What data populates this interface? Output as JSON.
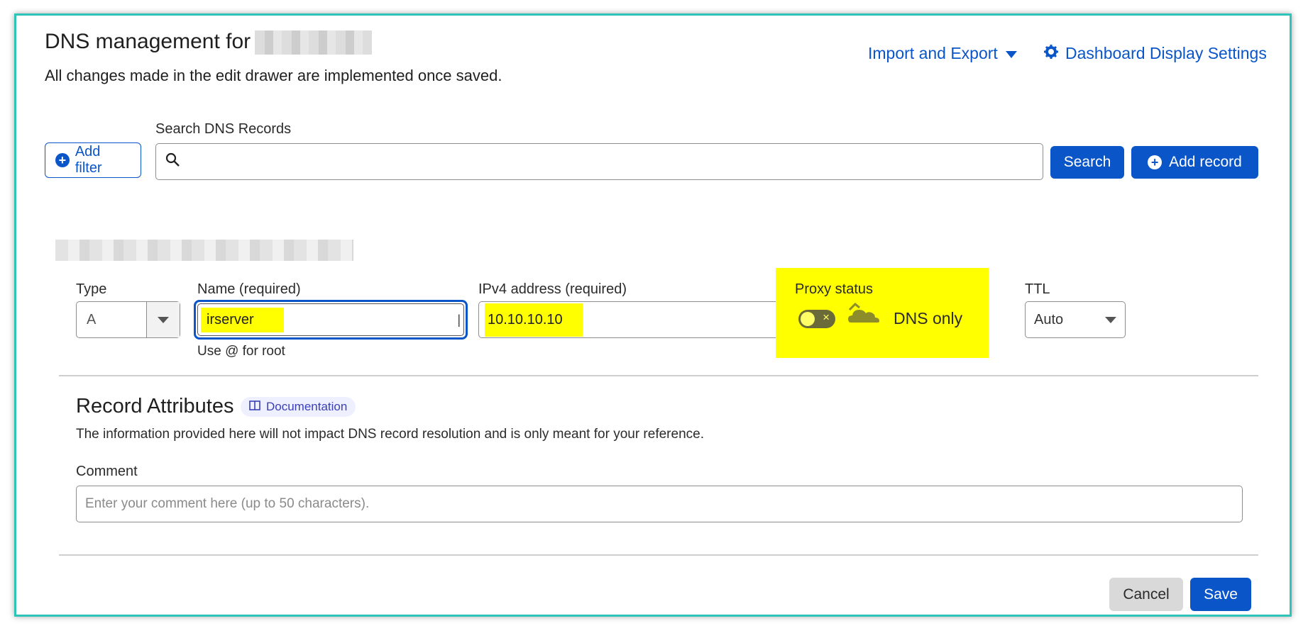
{
  "header": {
    "title": "DNS management for",
    "subtitle": "All changes made in the edit drawer are implemented once saved.",
    "import_export_label": "Import and Export",
    "dashboard_settings_label": "Dashboard Display Settings"
  },
  "search": {
    "add_filter_label": "Add filter",
    "label": "Search DNS Records",
    "value": "",
    "search_button_label": "Search",
    "add_record_label": "Add record"
  },
  "record_form": {
    "type_label": "Type",
    "type_value": "A",
    "name_label": "Name (required)",
    "name_value": "irserver",
    "name_hint": "Use @ for root",
    "ipv4_label": "IPv4 address (required)",
    "ipv4_value": "10.10.10.10",
    "proxy_label": "Proxy status",
    "proxy_value": "DNS only",
    "ttl_label": "TTL",
    "ttl_value": "Auto"
  },
  "attributes": {
    "heading": "Record Attributes",
    "doc_badge": "Documentation",
    "description": "The information provided here will not impact DNS record resolution and is only meant for your reference.",
    "comment_label": "Comment",
    "comment_placeholder": "Enter your comment here (up to 50 characters)."
  },
  "actions": {
    "cancel_label": "Cancel",
    "save_label": "Save"
  },
  "colors": {
    "accent": "#0a55c8",
    "highlight": "#ffff00",
    "frame": "#2fc4b8"
  }
}
